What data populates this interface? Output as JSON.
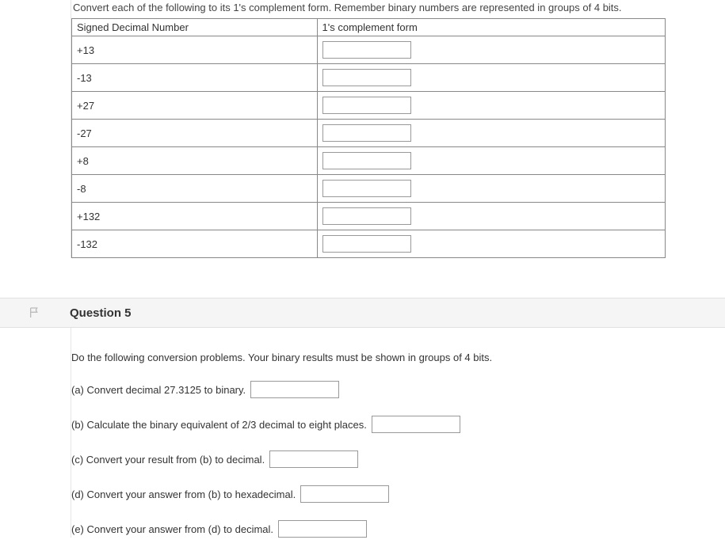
{
  "q4": {
    "instruction": "Convert each of the following to its 1's complement form.  Remember binary numbers are represented in groups of 4 bits.",
    "header_col1": "Signed Decimal Number",
    "header_col2": "1's complement form",
    "rows": [
      {
        "label": "+13"
      },
      {
        "label": "-13"
      },
      {
        "label": "+27"
      },
      {
        "label": "-27"
      },
      {
        "label": "+8"
      },
      {
        "label": "-8"
      },
      {
        "label": "+132"
      },
      {
        "label": "-132"
      }
    ]
  },
  "q5": {
    "title": "Question 5",
    "intro": "Do the following conversion problems.  Your binary results must be shown in groups of 4 bits.",
    "parts": {
      "a": "(a) Convert decimal 27.3125 to binary.",
      "b": "(b) Calculate the binary equivalent of 2/3 decimal to eight places.",
      "c": "(c) Convert your result from (b) to decimal.",
      "d": "(d) Convert your answer from (b) to hexadecimal.",
      "e": "(e) Convert your answer from (d) to decimal."
    }
  }
}
